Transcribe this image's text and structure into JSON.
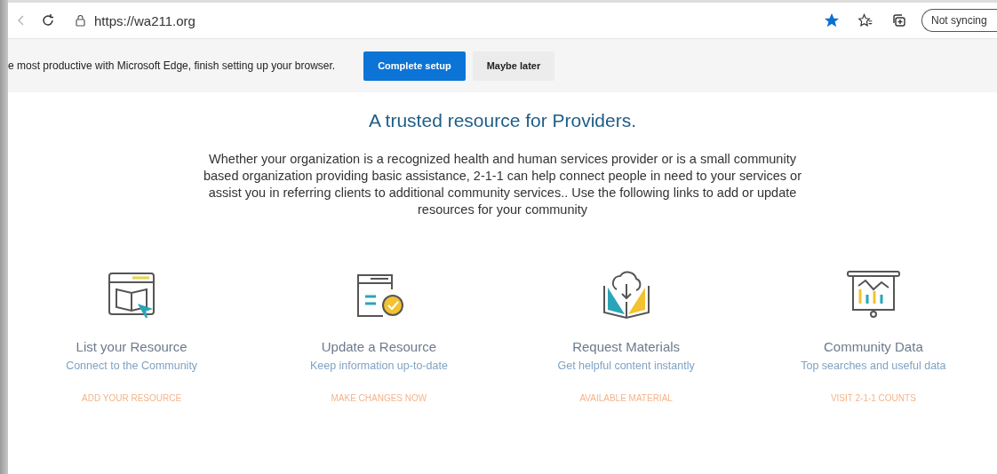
{
  "browser": {
    "url": "https://wa211.org",
    "favorite": true,
    "sync_label": "Not syncing"
  },
  "infobar": {
    "message": "e most productive with Microsoft Edge, finish setting up your browser.",
    "buttons": [
      {
        "label": "Complete setup",
        "primary": true
      },
      {
        "label": "Maybe later",
        "primary": false
      }
    ]
  },
  "page": {
    "heading": "A trusted resource for Providers.",
    "intro": "Whether your organization is a recognized health and human services provider or is a small community based organization providing basic assistance, 2-1-1 can help connect people in need to your services or assist you in referring clients to additional community services..  Use the following links to add or update resources for your community",
    "cards": [
      {
        "title": "List your Resource",
        "subtitle": "Connect to the Community",
        "link": "ADD YOUR RESOURCE"
      },
      {
        "title": "Update a Resource",
        "subtitle": "Keep information up-to-date",
        "link": "MAKE CHANGES NOW"
      },
      {
        "title": "Request Materials",
        "subtitle": "Get helpful content instantly",
        "link": "AVAILABLE MATERIAL"
      },
      {
        "title": "Community Data",
        "subtitle": "Top searches and useful data",
        "link": "VISIT 2-1-1 COUNTS"
      }
    ]
  }
}
